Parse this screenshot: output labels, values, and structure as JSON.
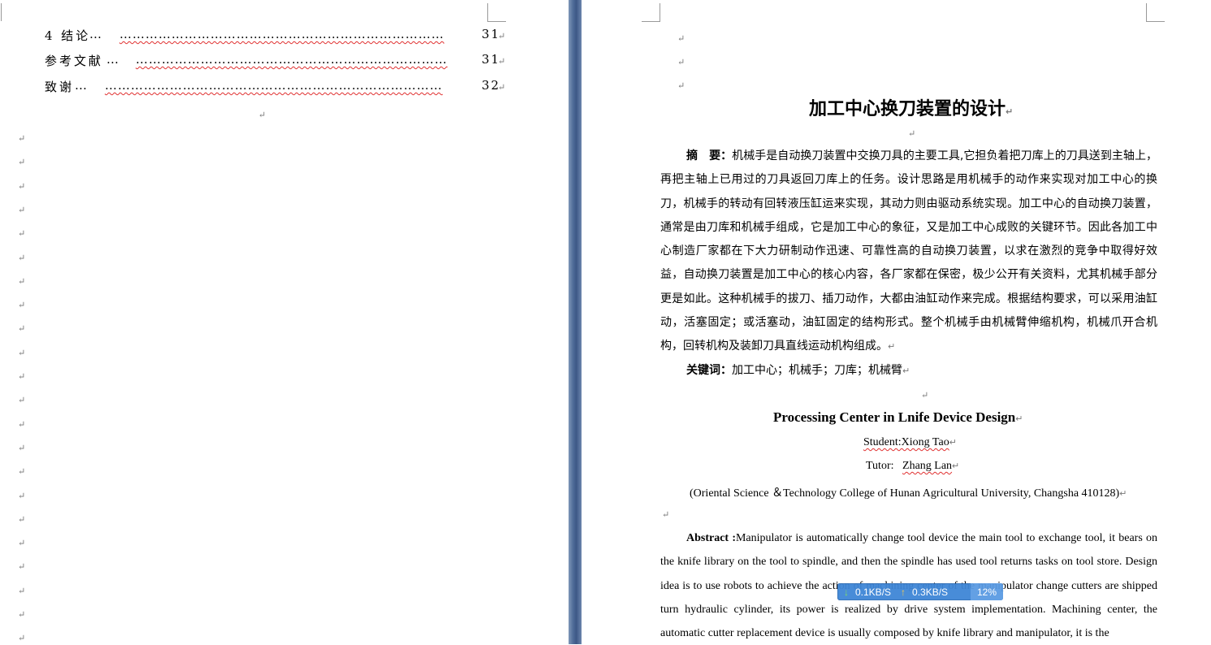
{
  "left_page": {
    "toc": [
      {
        "label": "4 结论",
        "page": "31"
      },
      {
        "label": "参考文献",
        "page": "31"
      },
      {
        "label": "致谢",
        "page": "32"
      }
    ],
    "paragraph_mark": "↵"
  },
  "right_page": {
    "title": "加工中心换刀装置的设计",
    "abstract_label": "摘　要：",
    "abstract_text": "机械手是自动换刀装置中交换刀具的主要工具,它担负着把刀库上的刀具送到主轴上，再把主轴上已用过的刀具返回刀库上的任务。设计思路是用机械手的动作来实现对加工中心的换刀，机械手的转动有回转液压缸运来实现，其动力则由驱动系统实现。加工中心的自动换刀装置，通常是由刀库和机械手组成，它是加工中心的象征，又是加工中心成败的关键环节。因此各加工中心制造厂家都在下大力研制动作迅速、可靠性高的自动换刀装置，以求在激烈的竞争中取得好效益，自动换刀装置是加工中心的核心内容，各厂家都在保密，极少公开有关资料，尤其机械手部分更是如此。这种机械手的拔刀、插刀动作，大都由油缸动作来完成。根据结构要求，可以采用油缸动，活塞固定；或活塞动，油缸固定的结构形式。整个机械手由机械臂伸缩机构，机械爪开合机构，回转机构及装卸刀具直线运动机构组成。",
    "keywords_label": "关键词：",
    "keywords_text": "加工中心；机械手；刀库；机械臂",
    "english_title": "Processing Center in Lnife Device Design",
    "student": "Student:Xiong  Tao",
    "tutor_label": "Tutor:",
    "tutor_name": "Zhang  Lan",
    "affiliation": "(Oriental Science  ＆Technology College of Hunan Agricultural University, Changsha 410128)",
    "abstract_en_label": "Abstract  :",
    "abstract_en_text": "Manipulator is automatically change tool device the main tool to exchange tool, it bears on the knife library on the tool to spindle, and then the spindle has used tool returns tasks on tool store. Design idea is to use robots to achieve the action of machining center of the manipulator change cutters are shipped turn hydraulic cylinder, its power is realized by drive system implementation. Machining center, the automatic cutter replacement device is usually composed by knife library and manipulator, it is the"
  },
  "network_monitor": {
    "download": "0.1KB/S",
    "upload": "0.3KB/S",
    "percent": "12%"
  }
}
